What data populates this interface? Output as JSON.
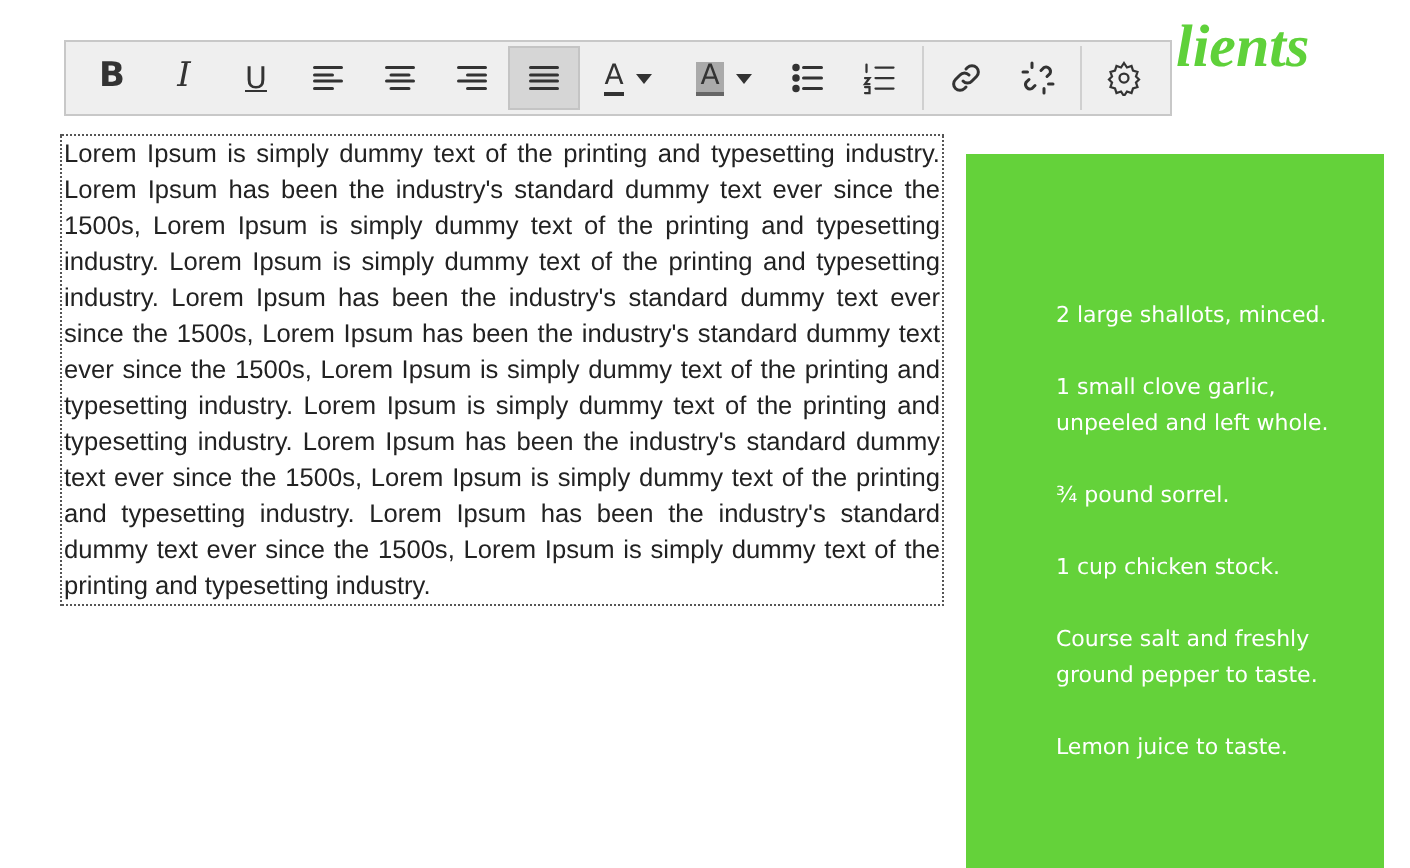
{
  "heading_right": {
    "text": "lients"
  },
  "toolbar": {
    "groups": [
      [
        {
          "kind": "bold",
          "label": "B",
          "selected": false
        },
        {
          "kind": "italic",
          "label": "I",
          "selected": false
        },
        {
          "kind": "underline",
          "label": "U",
          "selected": false
        },
        {
          "kind": "align-left",
          "selected": false
        },
        {
          "kind": "align-center",
          "selected": false
        },
        {
          "kind": "align-right",
          "selected": false
        },
        {
          "kind": "justify",
          "selected": true
        },
        {
          "kind": "font-color",
          "label": "A",
          "selected": false
        },
        {
          "kind": "background-color",
          "label": "A",
          "selected": false
        },
        {
          "kind": "bullet-list",
          "selected": false
        },
        {
          "kind": "numbered-list",
          "selected": false
        }
      ],
      [
        {
          "kind": "link",
          "selected": false
        },
        {
          "kind": "unlink",
          "selected": false
        }
      ],
      [
        {
          "kind": "settings",
          "selected": false
        }
      ]
    ]
  },
  "editor": {
    "text": "Lorem Ipsum is simply dummy text of the printing and typesetting industry. Lorem Ipsum has been the industry's standard dummy text ever since the 1500s, Lorem Ipsum is simply dummy text of the printing and typesetting industry. Lorem Ipsum is simply dummy text of the printing and typesetting industry. Lorem Ipsum has been the industry's standard dummy text ever since the 1500s, Lorem Ipsum has been the industry's standard dummy text ever since the 1500s, Lorem Ipsum is simply dummy text of the printing and typesetting industry. Lorem Ipsum is simply dummy text of the printing and typesetting industry. Lorem Ipsum has been the industry's standard dummy text ever since the 1500s, Lorem Ipsum is simply dummy text of the printing and typesetting industry. Lorem Ipsum has been the industry's standard dummy text ever since the 1500s, Lorem Ipsum is simply dummy text of the printing and typesetting industry."
  },
  "ingredients": [
    "2 large shallots, minced.",
    "1 small clove garlic, unpeeled and left whole.",
    "¾ pound sorrel.",
    "1 cup chicken stock.",
    "Course salt and freshly ground pepper to taste.",
    "Lemon juice to taste."
  ]
}
